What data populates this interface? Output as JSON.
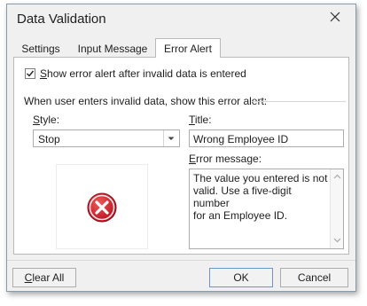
{
  "window": {
    "title": "Data Validation",
    "close_icon": "close-icon"
  },
  "tabs": [
    {
      "label": "Settings",
      "active": false
    },
    {
      "label": "Input Message",
      "active": false
    },
    {
      "label": "Error Alert",
      "active": true
    }
  ],
  "error_alert": {
    "show_alert_checkbox": {
      "checked": true,
      "label_mnemonic": "S",
      "label_rest": "how error alert after invalid data is entered"
    },
    "section_label": "When user enters invalid data, show this error alert:",
    "style": {
      "label_mnemonic": "S",
      "label_rest": "tyle:",
      "value": "Stop",
      "icon": "stop-error-icon"
    },
    "title_field": {
      "label_mnemonic": "T",
      "label_rest": "itle:",
      "value": "Wrong Employee ID"
    },
    "error_message": {
      "label_mnemonic": "E",
      "label_rest": "rror message:",
      "value": "The value you entered is not\nvalid. Use a five-digit number\nfor an Employee ID."
    }
  },
  "footer": {
    "clear_all": {
      "mnemonic": "C",
      "rest": "lear All"
    },
    "ok_label": "OK",
    "cancel_label": "Cancel"
  },
  "colors": {
    "dialog_bg": "#f0f0f0",
    "stop_icon_red": "#c8102e",
    "default_button_border": "#6b93cc"
  }
}
